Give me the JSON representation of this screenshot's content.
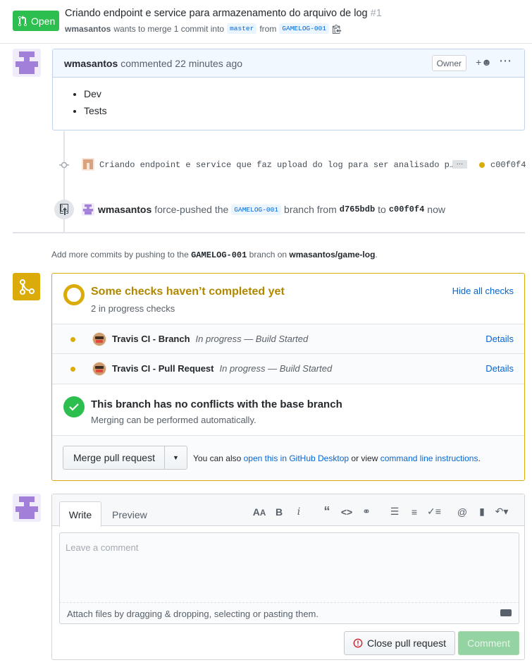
{
  "header": {
    "state": "Open",
    "title": "Criando endpoint e service para armazenamento do arquivo de log",
    "number": "#1",
    "author": "wmasantos",
    "meta_text": "wants to merge 1 commit into",
    "base_branch": "master",
    "from_text": "from",
    "head_branch": "GAMELOG-001"
  },
  "comment": {
    "author": "wmasantos",
    "action": "commented 22 minutes ago",
    "owner_badge": "Owner",
    "items": [
      "Dev",
      "Tests"
    ]
  },
  "commit": {
    "message": "Criando endpoint e service que faz upload do log para ser analisado p…",
    "ellipsis": "…",
    "sha": "c00f0f4",
    "status_color": "#dbab09"
  },
  "push": {
    "user": "wmasantos",
    "text1": "force-pushed the",
    "branch": "GAMELOG-001",
    "text2": "branch from",
    "from_sha": "d765bdb",
    "text3": "to",
    "to_sha": "c00f0f4",
    "text4": "now"
  },
  "add_commits": {
    "prefix": "Add more commits by pushing to the",
    "branch": "GAMELOG-001",
    "mid": "branch on",
    "repo": "wmasantos/game-log",
    "suffix": "."
  },
  "checks": {
    "title": "Some checks haven’t completed yet",
    "subtitle": "2 in progress checks",
    "hide_label": "Hide all checks",
    "items": [
      {
        "name": "Travis CI - Branch",
        "status": "In progress — Build Started",
        "details": "Details"
      },
      {
        "name": "Travis CI - Pull Request",
        "status": "In progress — Build Started",
        "details": "Details"
      }
    ]
  },
  "conflicts": {
    "title": "This branch has no conflicts with the base branch",
    "subtitle": "Merging can be performed automatically."
  },
  "merge": {
    "button": "Merge pull request",
    "hint_prefix": "You can also",
    "desktop_link": "open this in GitHub Desktop",
    "hint_mid": "or view",
    "cli_link": "command line instructions",
    "hint_suffix": "."
  },
  "form": {
    "tab_write": "Write",
    "tab_preview": "Preview",
    "placeholder": "Leave a comment",
    "attach_text": "Attach files by dragging & dropping, selecting or pasting them.",
    "close_button": "Close pull request",
    "comment_button": "Comment"
  },
  "colors": {
    "open_green": "#2cbe4e",
    "pending_yellow": "#dbab09",
    "link_blue": "#0366d6"
  }
}
